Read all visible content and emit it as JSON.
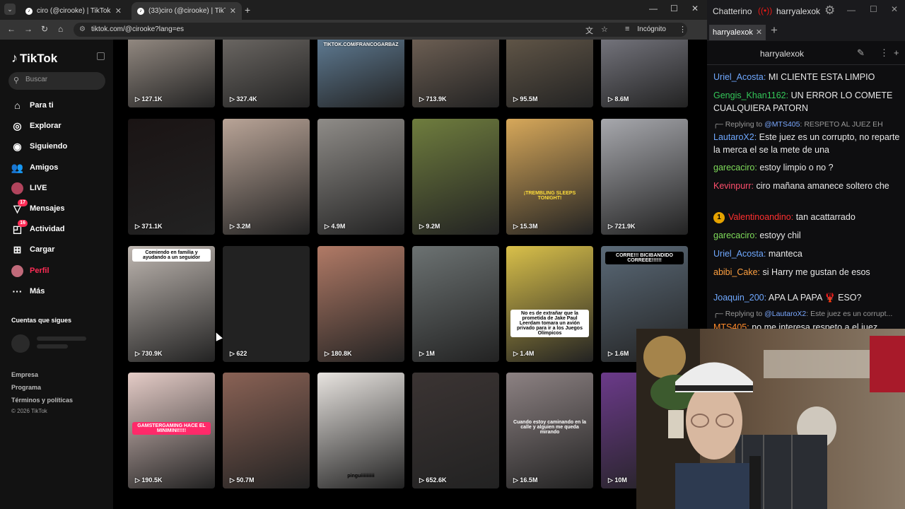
{
  "browser": {
    "tabs": [
      {
        "title": "ciro (@cirooke) | TikTok",
        "active": false
      },
      {
        "title": "(33)ciro (@cirooke) | TikTok",
        "active": true
      }
    ],
    "url": "tiktok.com/@cirooke?lang=es",
    "incognito_label": "Incógnito"
  },
  "sidebar": {
    "logo": "TikTok",
    "search_placeholder": "Buscar",
    "nav": [
      {
        "label": "Para ti",
        "icon": "home-icon"
      },
      {
        "label": "Explorar",
        "icon": "compass-icon"
      },
      {
        "label": "Siguiendo",
        "icon": "following-icon"
      },
      {
        "label": "Amigos",
        "icon": "friends-icon"
      },
      {
        "label": "LIVE",
        "icon": "live-icon"
      },
      {
        "label": "Mensajes",
        "icon": "messages-icon",
        "badge": "17"
      },
      {
        "label": "Actividad",
        "icon": "activity-icon",
        "badge": "16"
      },
      {
        "label": "Cargar",
        "icon": "upload-icon"
      },
      {
        "label": "Perfil",
        "icon": "profile-avatar-icon",
        "active": true
      },
      {
        "label": "Más",
        "icon": "more-icon"
      }
    ],
    "following_title": "Cuentas que sigues",
    "footer": [
      "Empresa",
      "Programa",
      "Términos y políticas"
    ],
    "copyright": "© 2026 TikTok"
  },
  "videos": [
    {
      "views": "127.1K",
      "color": "#c7b9ad"
    },
    {
      "views": "327.4K",
      "color": "#8c8680"
    },
    {
      "views": "",
      "color": "#7aa3c6",
      "caption": "TIKTOK.COM/FRANCOGARBAZ"
    },
    {
      "views": "713.9K",
      "color": "#8f7b6a"
    },
    {
      "views": "95.5M",
      "color": "#7d6d58"
    },
    {
      "views": "8.6M",
      "color": "#9a9aa6"
    },
    {
      "views": "371.1K",
      "color": "#1a1414"
    },
    {
      "views": "3.2M",
      "color": "#b9a497"
    },
    {
      "views": "4.9M",
      "color": "#8f8c88"
    },
    {
      "views": "9.2M",
      "color": "#6f7d3e"
    },
    {
      "views": "15.3M",
      "color": "#d7a85a",
      "caption": "¡TREMBLING SLEEPS TONIGHT!"
    },
    {
      "views": "721.9K",
      "color": "#a7a8ad"
    },
    {
      "views": "730.9K",
      "color": "#bfb7b1",
      "caption": "Comiendo en familia y ayudando a un seguidor"
    },
    {
      "views": "622",
      "color": "#222222"
    },
    {
      "views": "180.8K",
      "color": "#b17a66"
    },
    {
      "views": "1M",
      "color": "#6c7272"
    },
    {
      "views": "1.4M",
      "color": "#d9c04a",
      "caption": "No es de extrañar que la prometida de Jake Paul Leerdam tomara un avión privado para ir a los Juegos Olímpicos"
    },
    {
      "views": "1.6M",
      "color": "#5b6a78",
      "caption": "CORRE!!! BICIBANDIDO CORREEE!!!!!!"
    },
    {
      "views": "190.5K",
      "color": "#e5ccc7",
      "caption": "GAMSTERGAMING HACE EL MINIMINI!!!!!"
    },
    {
      "views": "50.7M",
      "color": "#8a6255"
    },
    {
      "views": "",
      "color": "#e8e4e0",
      "caption": "pinguiiiiiiiiii"
    },
    {
      "views": "652.6K",
      "color": "#3b3433"
    },
    {
      "views": "16.5M",
      "color": "#8d8283",
      "caption": "Cuando estoy caminando en la calle y alguien me queda mirando"
    },
    {
      "views": "10M",
      "color": "#6b3a8a"
    }
  ],
  "chat": {
    "app_title": "Chatterino",
    "channel": "harryalexok",
    "tab_label": "harryalexok",
    "messages": [
      {
        "type": "msg",
        "user": "Uriel_Acosta",
        "color": "#6fa8ff",
        "text": "MI CLIENTE ESTA LIMPIO"
      },
      {
        "type": "msg",
        "user": "Gengis_Khan1162",
        "color": "#34c759",
        "text": "UN ERROR LO COMETE CUALQUIERA PATORN"
      },
      {
        "type": "reply",
        "prefix": "Replying to ",
        "to": "@MTS405",
        "text": ": RESPETO AL JUEZ EH"
      },
      {
        "type": "msg",
        "user": "LautaroX2",
        "color": "#6fa8ff",
        "text": "Este juez es un corrupto, no reparte la merca el se la mete de una"
      },
      {
        "type": "msg",
        "user": "garecaciro",
        "color": "#7fdc5a",
        "text": "estoy limpio o no ?"
      },
      {
        "type": "msg",
        "user": "Kevinpurr",
        "color": "#ff4f6d",
        "text": "ciro mañana amanece soltero che"
      },
      {
        "type": "msg",
        "user": "Valentinoandino",
        "color": "#ff3030",
        "text": "tan acattarrado",
        "sub_badge": "1"
      },
      {
        "type": "msg",
        "user": "garecaciro",
        "color": "#7fdc5a",
        "text": "estoyy chil"
      },
      {
        "type": "msg",
        "user": "Uriel_Acosta",
        "color": "#6fa8ff",
        "text": "manteca"
      },
      {
        "type": "msg",
        "user": "abibi_Cake",
        "color": "#ffa040",
        "text": "si Harry me gustan de esos"
      },
      {
        "type": "msg",
        "user": "Joaquin_200",
        "color": "#6fa8ff",
        "text": "APA LA PAPA 🦞 ESO?"
      },
      {
        "type": "reply",
        "prefix": "Replying to ",
        "to": "@LautaroX2",
        "text": ": Este juez es un corrupt..."
      },
      {
        "type": "msg",
        "user": "MTS405",
        "color": "#ff8a2a",
        "text": "no me interesa respeto a el juez"
      }
    ]
  }
}
